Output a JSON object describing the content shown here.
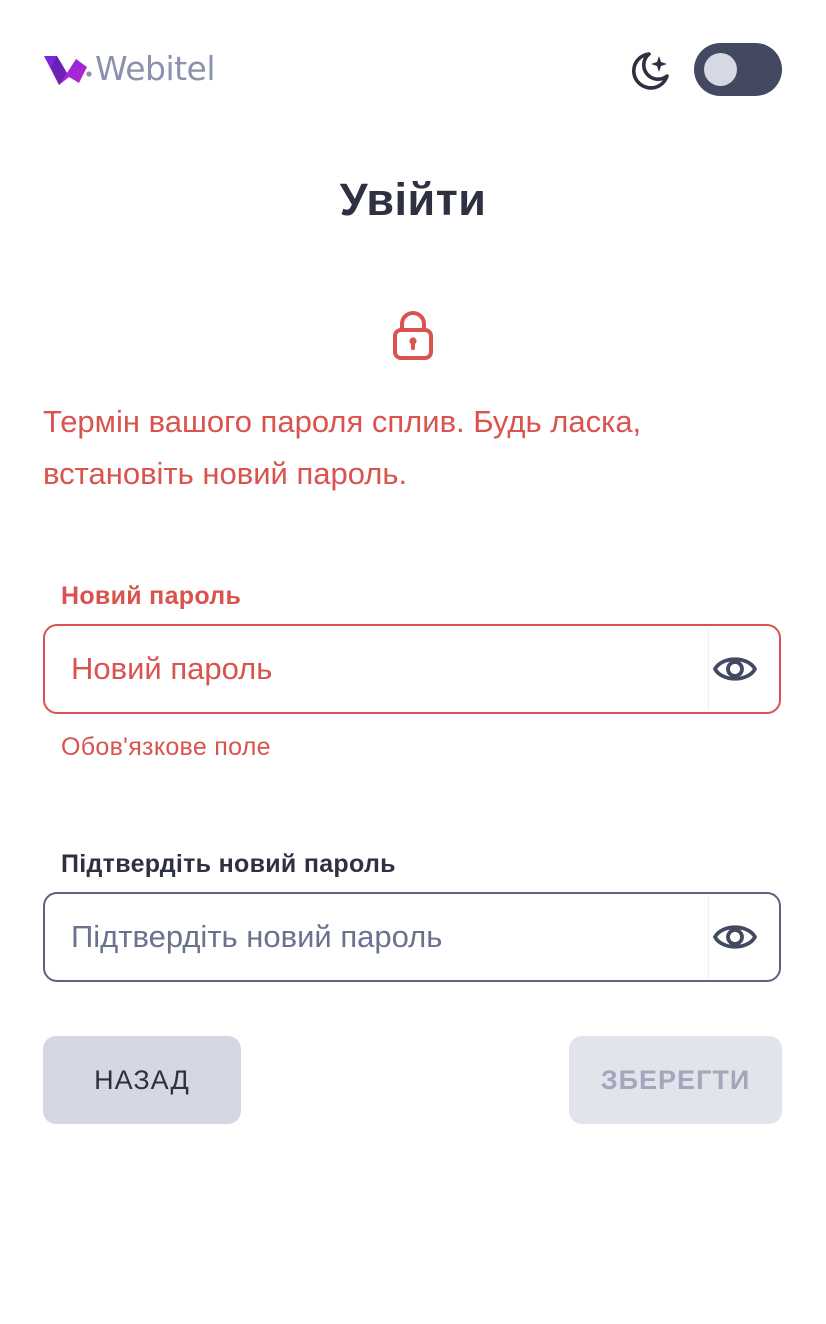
{
  "colors": {
    "brand": "#7c3aed",
    "error": "#d9534f",
    "text": "#2d3142",
    "toggle_bg": "#424961"
  },
  "header": {
    "logo_text": "Webitel",
    "theme_icon": "moon-stars-icon",
    "theme_toggle_on": false
  },
  "page": {
    "title": "Увійти",
    "lock_icon": "lock-icon",
    "expired_message": "Термін вашого пароля сплив. Будь ласка, встановіть новий пароль."
  },
  "form": {
    "new_password": {
      "label": "Новий пароль",
      "placeholder": "Новий пароль",
      "value": "",
      "error": "Обов'язкове поле",
      "toggle_icon": "eye-icon"
    },
    "confirm_password": {
      "label": "Підтвердіть новий пароль",
      "placeholder": "Підтвердіть новий пароль",
      "value": "",
      "toggle_icon": "eye-icon"
    }
  },
  "actions": {
    "back_label": "НАЗАД",
    "save_label": "ЗБЕРЕГТИ"
  }
}
